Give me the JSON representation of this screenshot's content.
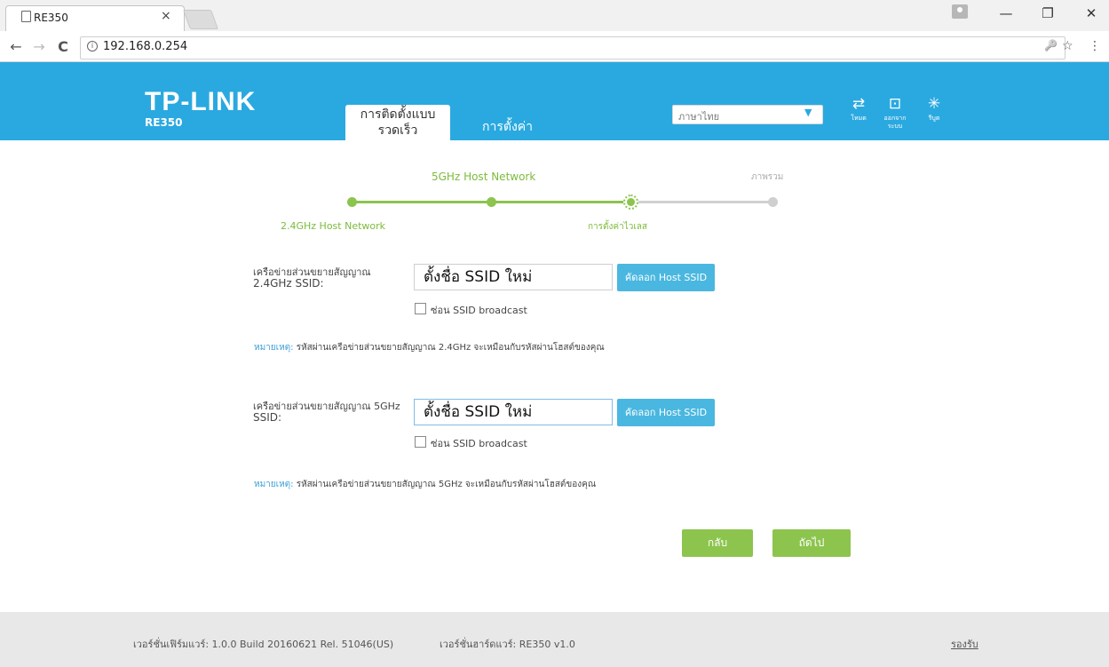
{
  "browser": {
    "tab_title": "RE350",
    "tab_close": "×",
    "url": "192.168.0.254",
    "url_info": "i",
    "back": "←",
    "forward": "→",
    "reload": "C",
    "bookmark_star": "☆",
    "key_icon": "🔑",
    "menu": "⋮",
    "window": {
      "minimize": "—",
      "maximize": "❐",
      "close": "✕"
    }
  },
  "header": {
    "logo": "TP-LINK",
    "model": "RE350",
    "tabs": [
      {
        "label_line1": "การติดตั้งแบบ",
        "label_line2": "รวดเร็ว",
        "active": true
      },
      {
        "label": "การตั้งค่า",
        "active": false
      }
    ],
    "language": "ภาษาไทย",
    "icons": [
      {
        "name": "mode-icon",
        "glyph": "⇄",
        "label": "โหมด"
      },
      {
        "name": "logout-icon",
        "glyph": "⊡",
        "label_line1": "ออกจาก",
        "label_line2": "ระบบ"
      },
      {
        "name": "reboot-icon",
        "glyph": "✳",
        "label": "รีบูต"
      }
    ]
  },
  "stepper": {
    "top_labels": [
      "5GHz Host Network",
      "ภาพรวม"
    ],
    "bottom_labels": [
      "2.4GHz Host Network",
      "การตั้งค่าไวเลส"
    ],
    "current_step": 3,
    "total_steps": 4
  },
  "form": {
    "ssid24": {
      "label_line1": "เครือข่ายส่วนขยายสัญญาณ",
      "label_line2": "2.4GHz SSID:",
      "value": "ตั้งชื่อ SSID ใหม่",
      "copy_button": "คัดลอก Host SSID",
      "hide_label": "ซ่อน SSID broadcast",
      "note_label": "หมายเหตุ:",
      "note_text": "รหัสผ่านเครือข่ายส่วนขยายสัญญาณ 2.4GHz จะเหมือนกับรหัสผ่านโฮสต์ของคุณ"
    },
    "ssid5": {
      "label_line1": "เครือข่ายส่วนขยายสัญญาณ 5GHz",
      "label_line2": "SSID:",
      "value": "ตั้งชื่อ SSID ใหม่",
      "copy_button": "คัดลอก Host SSID",
      "hide_label": "ซ่อน SSID broadcast",
      "note_label": "หมายเหตุ:",
      "note_text": "รหัสผ่านเครือข่ายส่วนขยายสัญญาณ 5GHz จะเหมือนกับรหัสผ่านโฮสต์ของคุณ"
    },
    "back_button": "กลับ",
    "next_button": "ถัดไป"
  },
  "footer": {
    "firmware": "เวอร์ชั่นเฟิร์มแวร์: 1.0.0 Build 20160621 Rel. 51046(US)",
    "hardware": "เวอร์ชั่นฮาร์ดแวร์: RE350 v1.0",
    "support": "รองรับ"
  }
}
